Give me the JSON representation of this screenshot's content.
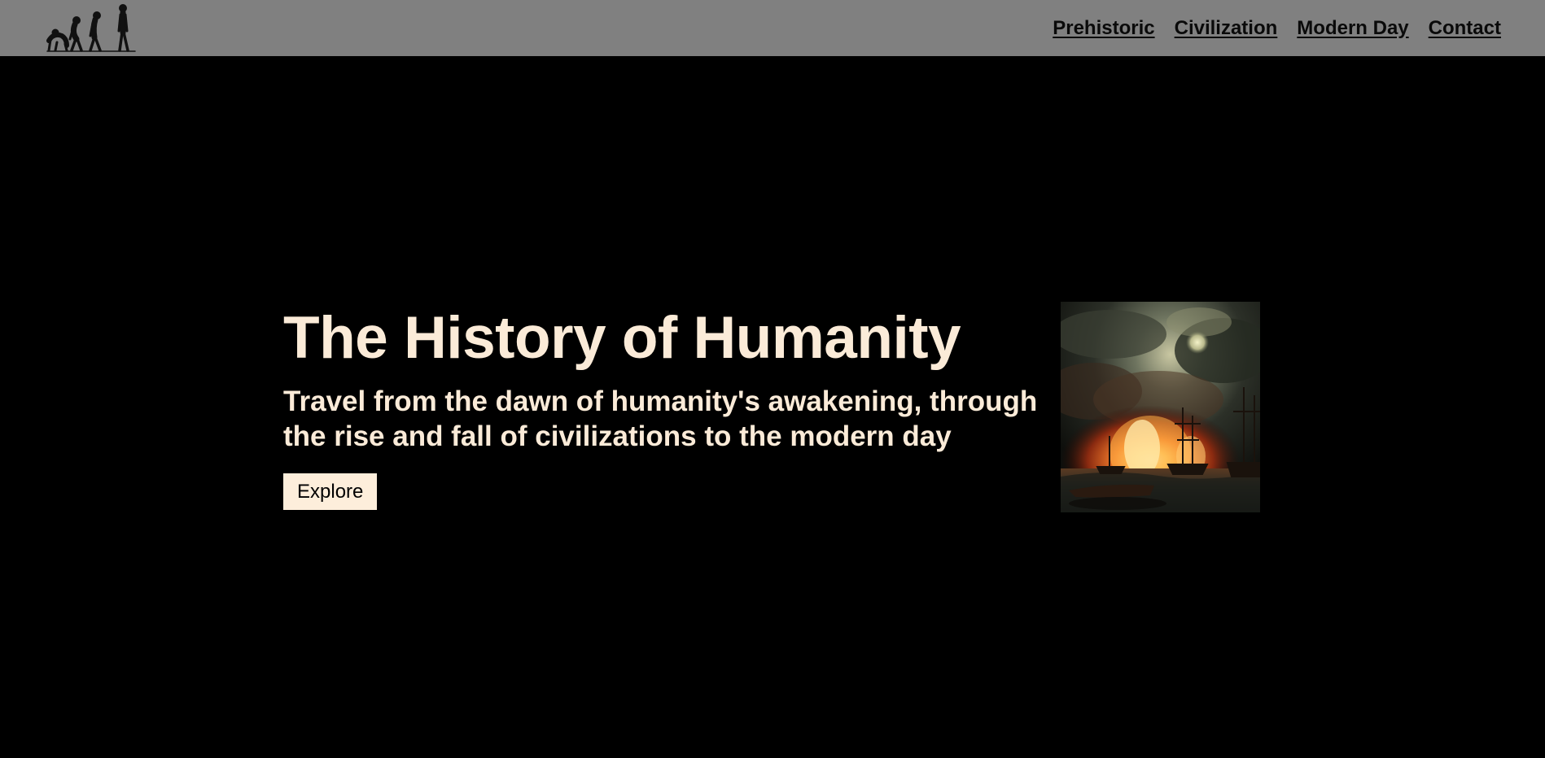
{
  "nav": {
    "logo_icon": "evolution-silhouette-icon",
    "links": [
      {
        "label": "Prehistoric"
      },
      {
        "label": "Civilization"
      },
      {
        "label": "Modern Day"
      },
      {
        "label": "Contact"
      }
    ]
  },
  "hero": {
    "title": "The History of Humanity",
    "subtitle": "Travel from the dawn of humanity's awakening, through the rise and fall of civilizations to the modern day",
    "button_label": "Explore",
    "image_icon": "naval-battle-painting"
  },
  "colors": {
    "navbar_bg": "#808080",
    "page_bg": "#000000",
    "text_cream": "#fbebd8",
    "button_bg": "#fdeedb"
  }
}
